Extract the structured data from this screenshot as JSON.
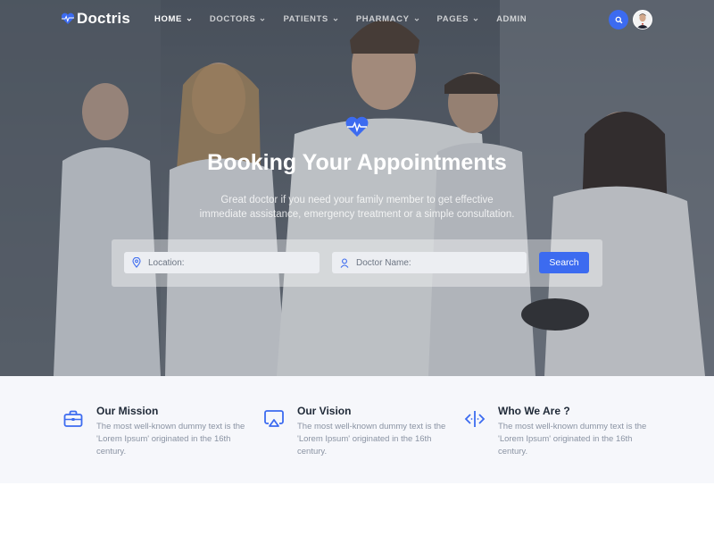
{
  "brand": {
    "name": "Doctris",
    "accent": "#3c6bf0"
  },
  "nav": {
    "items": [
      {
        "label": "HOME",
        "has_dropdown": true,
        "active": true
      },
      {
        "label": "DOCTORS",
        "has_dropdown": true,
        "active": false
      },
      {
        "label": "PATIENTS",
        "has_dropdown": true,
        "active": false
      },
      {
        "label": "PHARMACY",
        "has_dropdown": true,
        "active": false
      },
      {
        "label": "PAGES",
        "has_dropdown": true,
        "active": false
      },
      {
        "label": "ADMIN",
        "has_dropdown": false,
        "active": false
      }
    ],
    "search_icon": "search-icon",
    "avatar_icon": "user-avatar"
  },
  "hero": {
    "title": "Booking Your Appointments",
    "subtitle": "Great doctor if you need your family member to get effective immediate assistance, emergency treatment or a simple consultation.",
    "badge_icon": "heart-pulse-icon"
  },
  "search": {
    "location_placeholder": "Location:",
    "doctor_placeholder": "Doctor Name:",
    "button_label": "Search"
  },
  "features": [
    {
      "title": "Our Mission",
      "text": "The most well-known dummy text is the 'Lorem Ipsum' originated in the 16th century.",
      "icon": "briefcase-icon"
    },
    {
      "title": "Our Vision",
      "text": "The most well-known dummy text is the 'Lorem Ipsum' originated in the 16th century.",
      "icon": "airplay-icon"
    },
    {
      "title": "Who We Are ?",
      "text": "The most well-known dummy text is the 'Lorem Ipsum' originated in the 16th century.",
      "icon": "code-icon"
    }
  ]
}
